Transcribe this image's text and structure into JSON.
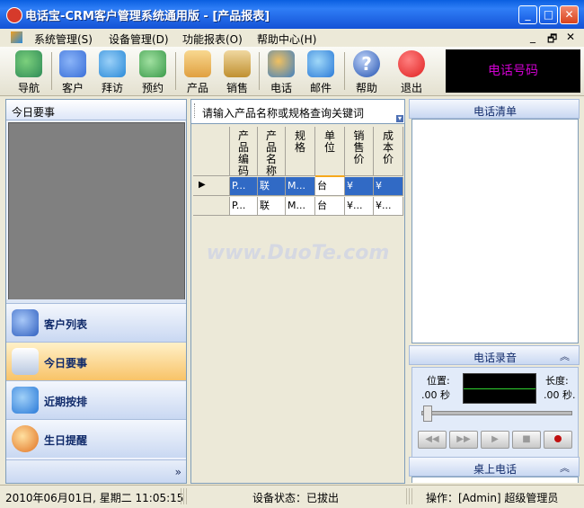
{
  "window": {
    "title": "电话宝-CRM客户管理系统通用版 - [产品报表]",
    "controls": {
      "minimize": "_",
      "maximize": "□",
      "close": "✕"
    }
  },
  "menu": {
    "items": [
      "系统管理(S)",
      "设备管理(D)",
      "功能报表(O)",
      "帮助中心(H)"
    ],
    "mdi_controls": {
      "minimize": "_",
      "restore": "🗗",
      "close": "✕"
    }
  },
  "toolbar": {
    "buttons": [
      {
        "label": "导航",
        "icon": "navigation-icon",
        "color": "#2e8b57"
      },
      {
        "label": "客户",
        "icon": "customers-icon",
        "color": "#3a6fd8"
      },
      {
        "label": "拜访",
        "icon": "visit-icon",
        "color": "#2a8ad8"
      },
      {
        "label": "预约",
        "icon": "appointment-icon",
        "color": "#3a9a4a"
      },
      {
        "label": "产品",
        "icon": "product-icon",
        "color": "#e0a040"
      },
      {
        "label": "销售",
        "icon": "sales-icon",
        "color": "#c09030"
      },
      {
        "label": "电话",
        "icon": "phone-icon",
        "color": "#4080c0"
      },
      {
        "label": "邮件",
        "icon": "mail-icon",
        "color": "#2a7ad8"
      },
      {
        "label": "帮助",
        "icon": "help-icon",
        "color": "#2050b0"
      },
      {
        "label": "退出",
        "icon": "exit-icon",
        "color": "#e02020"
      }
    ],
    "phone_display": "电话号码"
  },
  "left_panel": {
    "title": "今日要事",
    "nav": [
      {
        "label": "客户列表",
        "icon": "customer-list-icon",
        "active": false
      },
      {
        "label": "今日要事",
        "icon": "today-events-icon",
        "active": true
      },
      {
        "label": "近期按排",
        "icon": "schedule-icon",
        "active": false
      },
      {
        "label": "生日提醒",
        "icon": "birthday-icon",
        "active": false
      }
    ],
    "more": "»"
  },
  "middle_panel": {
    "search_placeholder": "请输入产品名称或规格查询关键词",
    "columns": [
      "产品编码",
      "产品名称",
      "规格",
      "单位",
      "销售价",
      "成本价"
    ],
    "rows": [
      [
        "P...",
        "联",
        "M...",
        "台",
        "¥",
        "¥"
      ],
      [
        "P...",
        "联",
        "M...",
        "台",
        "¥...",
        "¥..."
      ]
    ],
    "watermark": "www.DuoTe.com"
  },
  "right_panel": {
    "call_list_title": "电话清单",
    "recording_title": "电话录音",
    "position_label": "位置:",
    "position_value": ".00 秒",
    "length_label": "长度:",
    "length_value": ".00 秒.",
    "desk_phone_title": "桌上电话",
    "collapse": "︽"
  },
  "status": {
    "datetime": "2010年06月01日, 星期二    11:05:15",
    "device": "设备状态：已拔出",
    "operator": "操作：[Admin] 超级管理员"
  }
}
